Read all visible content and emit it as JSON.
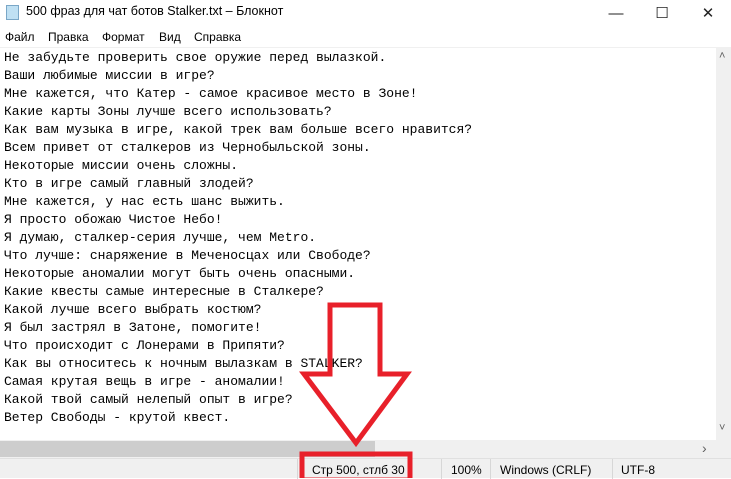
{
  "window": {
    "title": "500 фраз для чат ботов Stalker.txt – Блокнот",
    "minimize": "—",
    "maximize": "☐",
    "close": "✕"
  },
  "menu": [
    "Файл",
    "Правка",
    "Формат",
    "Вид",
    "Справка"
  ],
  "lines": [
    "Не забудьте проверить свое оружие перед вылазкой.",
    "Ваши любимые миссии в игре?",
    "Мне кажется, что Катер - самое красивое место в Зоне!",
    "Какие карты Зоны лучше всего использовать?",
    "Как вам музыка в игре, какой трек вам больше всего нравится?",
    "Всем привет от сталкеров из Чернобыльской зоны.",
    "Некоторые миссии очень сложны.",
    "Кто в игре самый главный злодей?",
    "Мне кажется, у нас есть шанс выжить.",
    "Я просто обожаю Чистое Небо!",
    "Я думаю, сталкер-серия лучше, чем Metro.",
    "Что лучше: снаряжение в Меченосцах или Свободе?",
    "Некоторые аномалии могут быть очень опасными.",
    "Какие квесты самые интересные в Сталкере?",
    "Какой лучше всего выбрать костюм?",
    "Я был застрял в Затоне, помогите!",
    "Что происходит с Лонерами в Припяти?",
    "Как вы относитесь к ночным вылазкам в STALKER?",
    "Самая крутая вещь в игре - аномалии!",
    "Какой твой самый нелепый опыт в игре?",
    "Ветер Свободы - крутой квест."
  ],
  "status": {
    "position": "Стр 500, стлб 30",
    "zoom": "100%",
    "line_ending": "Windows (CRLF)",
    "encoding": "UTF-8"
  },
  "scroll": {
    "up": "˄",
    "down": "˅",
    "right": "›"
  },
  "annotation_color": "#e8202a"
}
